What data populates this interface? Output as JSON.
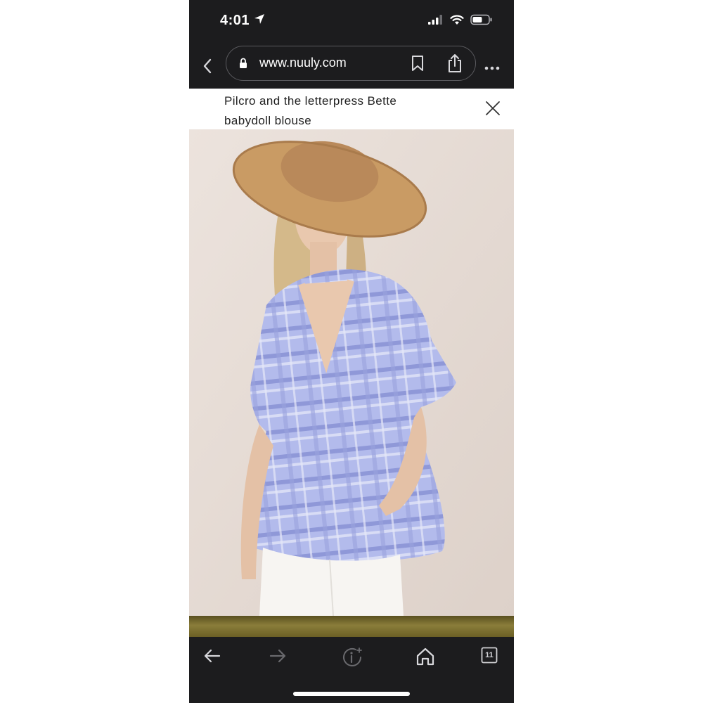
{
  "status_bar": {
    "time": "4:01"
  },
  "browser": {
    "url": "www.nuuly.com"
  },
  "page": {
    "title": "Pilcro and the letterpress Bette babydoll blouse"
  },
  "toolbar": {
    "tab_count": "11"
  },
  "colors": {
    "chrome": "#1c1c1e",
    "page_bg": "#ffffff",
    "blouse": "#a9b1e6",
    "photo_bg": "#e6dcd5"
  },
  "icons": [
    "location-arrow-icon",
    "signal-icon",
    "wifi-icon",
    "battery-icon",
    "back-chevron-icon",
    "lock-icon",
    "bookmark-icon",
    "share-icon",
    "more-icon",
    "close-icon",
    "back-arrow-icon",
    "forward-arrow-icon",
    "info-icon",
    "home-icon",
    "tabs-icon"
  ]
}
